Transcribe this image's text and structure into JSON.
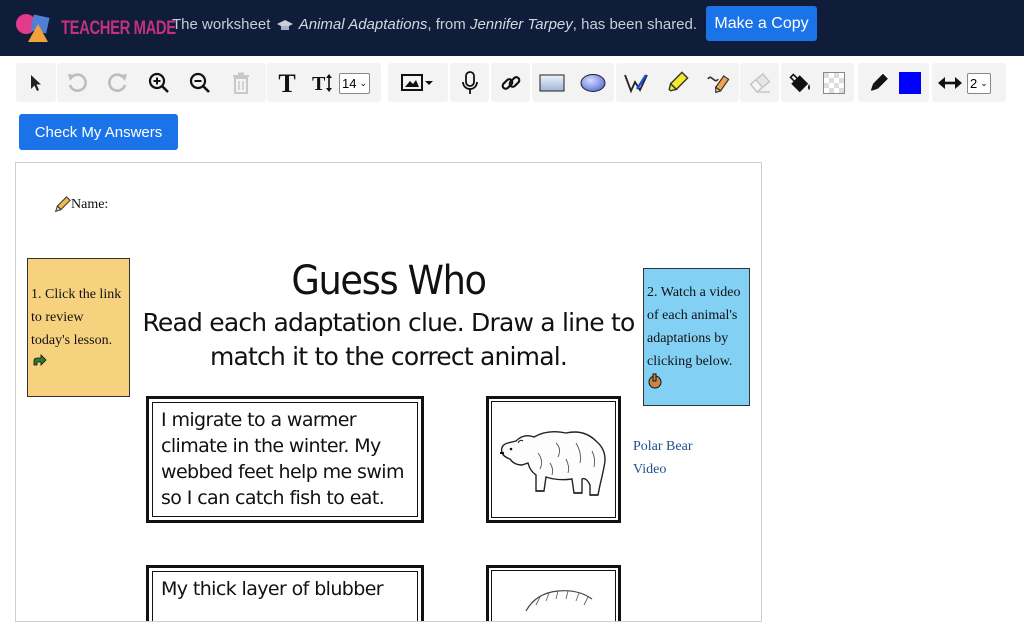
{
  "header": {
    "logo_text": "TEACHER MADE",
    "share_prefix": "The worksheet",
    "worksheet_title": "Animal Adaptations",
    "share_from": ", from",
    "author": "Jennifer Tarpey",
    "share_suffix": ", has been shared.",
    "copy_label": "Make a Copy"
  },
  "toolbar": {
    "font_size": "14",
    "line_width": "2",
    "pen_color": "#0000ff"
  },
  "actions": {
    "check_label": "Check My Answers"
  },
  "worksheet": {
    "name_label": "Name:",
    "note1": "1. Click the link to review today's lesson.",
    "note2": "2. Watch a video of each animal's adaptations by clicking below.",
    "title": "Guess Who",
    "subtitle": "Read each adaptation clue. Draw a line to match it to the correct animal.",
    "clue1": "I migrate to a warmer climate in the winter. My webbed feet help me swim so I can catch fish to eat.",
    "clue2": "My thick layer of blubber",
    "video1": "Polar Bear Video"
  }
}
